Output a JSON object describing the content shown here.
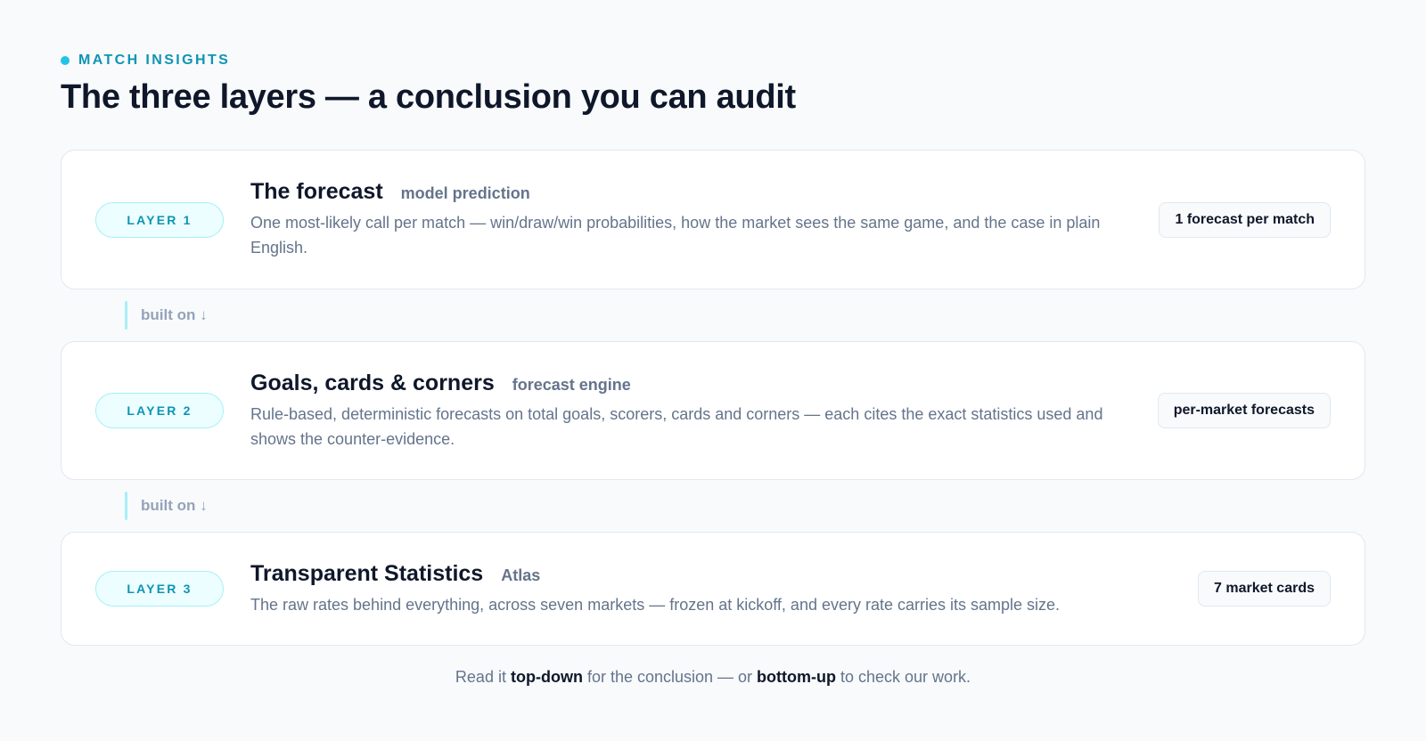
{
  "header": {
    "eyebrow": "MATCH INSIGHTS",
    "title": "The three layers — a conclusion you can audit"
  },
  "layers": [
    {
      "badge": "LAYER 1",
      "title": "The forecast",
      "subtitle": "model prediction",
      "description": "One most-likely call per match — win/draw/win probabilities, how the market sees the same game, and the case in plain English.",
      "tag": "1 forecast per match"
    },
    {
      "badge": "LAYER 2",
      "title": "Goals, cards & corners",
      "subtitle": "forecast engine",
      "description": "Rule-based, deterministic forecasts on total goals, scorers, cards and corners — each cites the exact statistics used and shows the counter-evidence.",
      "tag": "per-market forecasts"
    },
    {
      "badge": "LAYER 3",
      "title": "Transparent Statistics",
      "subtitle": "Atlas",
      "description": "The raw rates behind everything, across seven markets — frozen at kickoff, and every rate carries its sample size.",
      "tag": "7 market cards"
    }
  ],
  "connectors": [
    "built on ↓",
    "built on ↓"
  ],
  "footer": {
    "part1": "Read it ",
    "bold1": "top-down",
    "part2": " for the conclusion — or ",
    "bold2": "bottom-up",
    "part3": " to check our work."
  },
  "colors": {
    "accent": "#22c3e6",
    "accent_text": "#0e94b3",
    "background": "#f8fafc"
  }
}
